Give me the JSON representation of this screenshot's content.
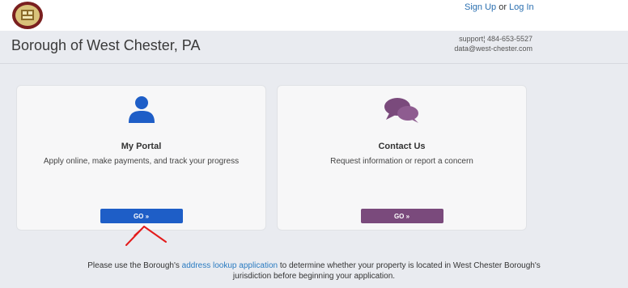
{
  "auth": {
    "signup": "Sign Up",
    "or": "or",
    "login": "Log In"
  },
  "header": {
    "title": "Borough of West Chester, PA",
    "support_label": "support",
    "support_phone": "484-653-5527",
    "support_email": "data@west-chester.com"
  },
  "cards": [
    {
      "icon": "user-icon",
      "title": "My Portal",
      "description": "Apply online, make payments, and track your progress",
      "button": "GO »",
      "color": "#1e5ec7"
    },
    {
      "icon": "chat-icon",
      "title": "Contact Us",
      "description": "Request information or report a concern",
      "button": "GO »",
      "color": "#7a4a7c"
    }
  ],
  "notice": {
    "before": "Please use the Borough's",
    "link": "address lookup application",
    "after": "to determine whether your property is located in West Chester Borough's",
    "line2": "jurisdiction before beginning your application."
  },
  "colors": {
    "accent_blue": "#1e5ec7",
    "accent_purple": "#7a4a7c",
    "annotation_red": "#e31b1b"
  }
}
